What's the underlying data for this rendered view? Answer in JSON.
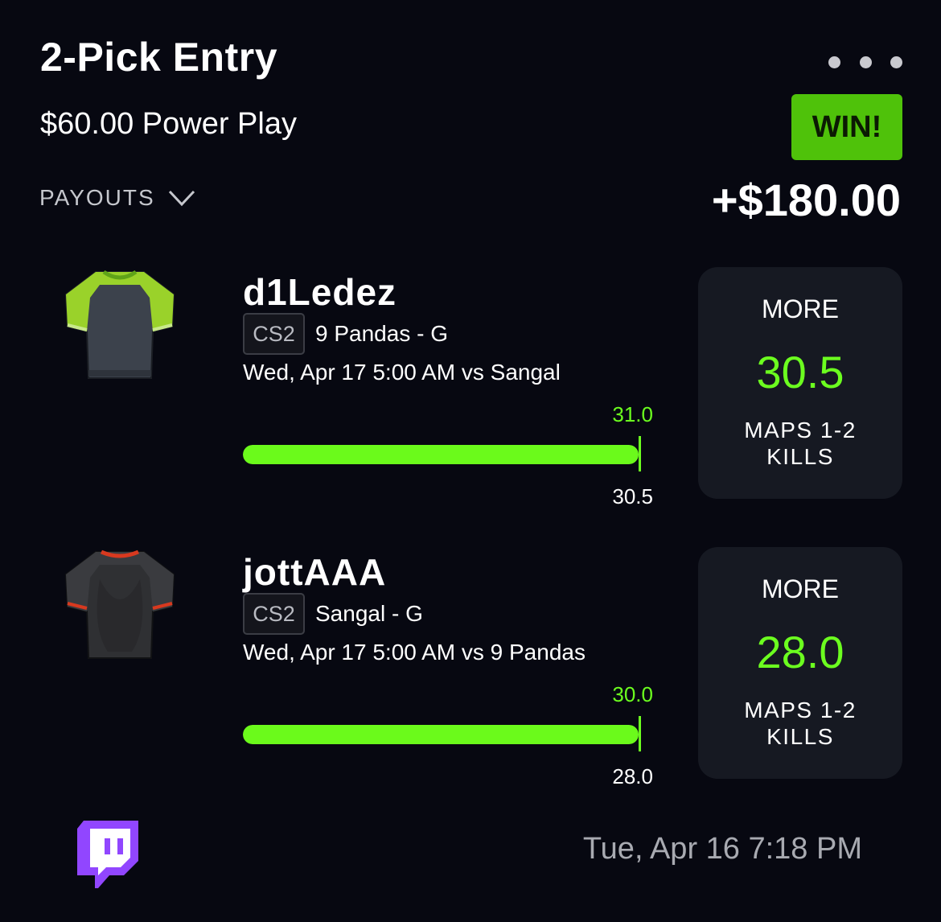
{
  "entry": {
    "title": "2-Pick Entry",
    "subtitle": "$60.00 Power Play",
    "status_badge": "WIN!",
    "payouts_label": "PAYOUTS",
    "payout_amount": "+$180.00",
    "timestamp": "Tue, Apr 16 7:18 PM"
  },
  "picks": [
    {
      "player": "d1Ledez",
      "game": "CS2",
      "team_pos": "9 Pandas - G",
      "match": "Wed, Apr 17 5:00 AM  vs Sangal",
      "actual": "31.0",
      "line": "30.5",
      "direction": "MORE",
      "stat": "MAPS 1-2\nKILLS",
      "jersey": "green-sleeve-jersey-icon",
      "progress": 1.0
    },
    {
      "player": "jottAAA",
      "game": "CS2",
      "team_pos": "Sangal - G",
      "match": "Wed, Apr 17 5:00 AM  vs 9 Pandas",
      "actual": "30.0",
      "line": "28.0",
      "direction": "MORE",
      "stat": "MAPS 1-2\nKILLS",
      "jersey": "black-red-jersey-icon",
      "progress": 1.0
    }
  ],
  "colors": {
    "background": "#070811",
    "accent_green": "#6cff1f",
    "win_badge": "#4fc20a",
    "card": "#161922",
    "twitch_purple": "#9146ff"
  },
  "icons": {
    "more": "more-dots-icon",
    "payouts_toggle": "chevron-down-icon",
    "stream": "twitch-icon"
  }
}
